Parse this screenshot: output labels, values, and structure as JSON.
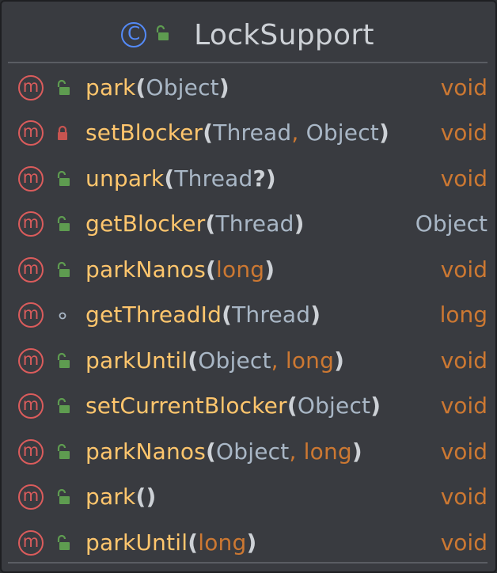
{
  "header": {
    "class_icon_letter": "C",
    "class_name": "LockSupport",
    "visibility": "public"
  },
  "members": [
    {
      "name": "park",
      "params": [
        {
          "t": "Object",
          "prim": false
        }
      ],
      "ret": "void",
      "ret_prim": true,
      "vis": "public"
    },
    {
      "name": "setBlocker",
      "params": [
        {
          "t": "Thread",
          "prim": false
        },
        {
          "t": "Object",
          "prim": false
        }
      ],
      "ret": "void",
      "ret_prim": true,
      "vis": "private"
    },
    {
      "name": "unpark",
      "params": [
        {
          "t": "Thread",
          "prim": false,
          "nullable": true
        }
      ],
      "ret": "void",
      "ret_prim": true,
      "vis": "public"
    },
    {
      "name": "getBlocker",
      "params": [
        {
          "t": "Thread",
          "prim": false
        }
      ],
      "ret": "Object",
      "ret_prim": false,
      "vis": "public"
    },
    {
      "name": "parkNanos",
      "params": [
        {
          "t": "long",
          "prim": true
        }
      ],
      "ret": "void",
      "ret_prim": true,
      "vis": "public"
    },
    {
      "name": "getThreadId",
      "params": [
        {
          "t": "Thread",
          "prim": false
        }
      ],
      "ret": "long",
      "ret_prim": true,
      "vis": "package"
    },
    {
      "name": "parkUntil",
      "params": [
        {
          "t": "Object",
          "prim": false
        },
        {
          "t": "long",
          "prim": true
        }
      ],
      "ret": "void",
      "ret_prim": true,
      "vis": "public"
    },
    {
      "name": "setCurrentBlocker",
      "params": [
        {
          "t": "Object",
          "prim": false
        }
      ],
      "ret": "void",
      "ret_prim": true,
      "vis": "public"
    },
    {
      "name": "parkNanos",
      "params": [
        {
          "t": "Object",
          "prim": false
        },
        {
          "t": "long",
          "prim": true
        }
      ],
      "ret": "void",
      "ret_prim": true,
      "vis": "public"
    },
    {
      "name": "park",
      "params": [],
      "ret": "void",
      "ret_prim": true,
      "vis": "public"
    },
    {
      "name": "parkUntil",
      "params": [
        {
          "t": "long",
          "prim": true
        }
      ],
      "ret": "void",
      "ret_prim": true,
      "vis": "public"
    }
  ],
  "method_icon_letter": "m",
  "colors": {
    "class_icon": "#548af7",
    "method_icon": "#db5c5c",
    "method_name": "#ffc66d",
    "primitive_type": "#cc7832",
    "reference_type": "#a9b7c6",
    "public_lock": "#5e9c50",
    "private_lock": "#c75450",
    "package_dot": "#a9b7c6"
  }
}
